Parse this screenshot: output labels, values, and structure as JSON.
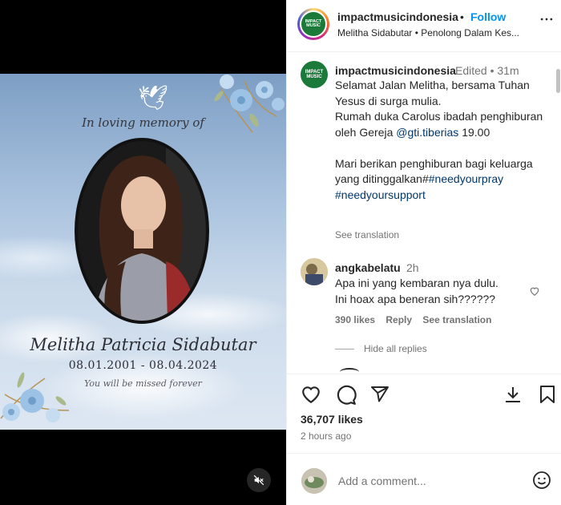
{
  "post_image": {
    "memory_line": "In loving memory of",
    "name": "Melitha Patricia Sidabutar",
    "dates": "08.01.2001 - 08.04.2024",
    "missed_line": "You will be missed forever"
  },
  "header": {
    "username": "impactmusicindonesia",
    "separator": "•",
    "follow_label": "Follow",
    "subtitle": "Melitha Sidabutar • Penolong Dalam Kes...",
    "avatar_text": "IMPACT MUSIC"
  },
  "caption": {
    "username": "impactmusicindonesia",
    "edited": "Edited",
    "separator": "•",
    "time": "31m",
    "line1": "Selamat Jalan Melitha, bersama Tuhan Yesus di surga mulia.",
    "line2_pre": "Rumah duka Carolus ibadah penghiburan oleh Gereja ",
    "mention": "@gti.tiberias",
    "line2_post": " 19.00",
    "line3_pre": "Mari berikan penghiburan bagi keluarga yang ditinggalkan#",
    "hashtag1": "#needyourpray",
    "hashtag2": "#needyoursupport",
    "see_translation": "See translation"
  },
  "comment": {
    "username": "angkabelatu",
    "time": "2h",
    "text": "Apa ini yang kembaran nya dulu.\nIni hoax apa beneran sih??????",
    "likes": "390 likes",
    "reply": "Reply",
    "see_translation": "See translation",
    "hide_replies": "Hide all replies"
  },
  "actions": {
    "likes": "36,707 likes",
    "time_ago": "2 hours ago",
    "add_comment_placeholder": "Add a comment..."
  },
  "icons": [
    "heart-icon",
    "comment-icon",
    "share-icon",
    "download-icon",
    "bookmark-icon",
    "mute-icon",
    "emoji-icon",
    "more-icon"
  ],
  "colors": {
    "accent": "#0095f6",
    "link": "#00376b",
    "muted": "#737373"
  }
}
